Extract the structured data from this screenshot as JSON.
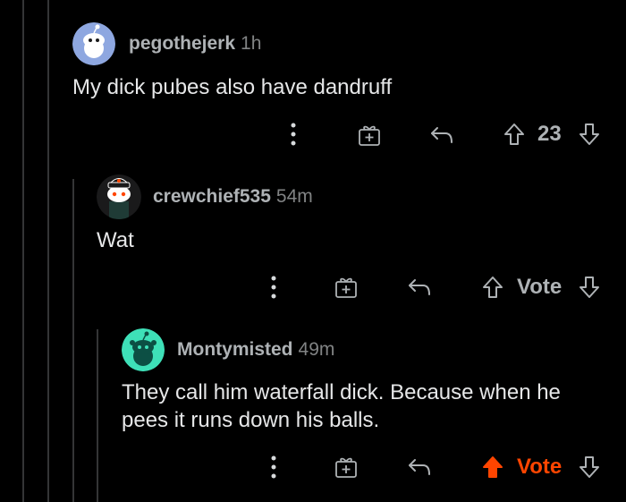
{
  "comments": [
    {
      "username": "pegothejerk",
      "age": "1h",
      "body": "My dick pubes also have dandruff",
      "vote_label": "23",
      "upvoted": false,
      "avatar_color": "#8ea7e0"
    },
    {
      "username": "crewchief535",
      "age": "54m",
      "body": "Wat",
      "vote_label": "Vote",
      "upvoted": false,
      "avatar_color": "#1a1a1b"
    },
    {
      "username": "Montymisted",
      "age": "49m",
      "body_lines": [
        "They call him waterfall dick. Because when he",
        "pees it runs down his balls."
      ],
      "vote_label": "Vote",
      "upvoted": true,
      "avatar_color": "#3ee0b8"
    }
  ],
  "icons": {
    "more": "more-options-icon",
    "award": "award-gift-icon",
    "reply": "reply-arrow-icon",
    "upvote": "upvote-arrow-icon",
    "downvote": "downvote-arrow-icon"
  },
  "colors": {
    "background": "#000000",
    "thread_line": "#343536",
    "upvote_active": "#ff4500",
    "icon": "#aeb2b5"
  }
}
